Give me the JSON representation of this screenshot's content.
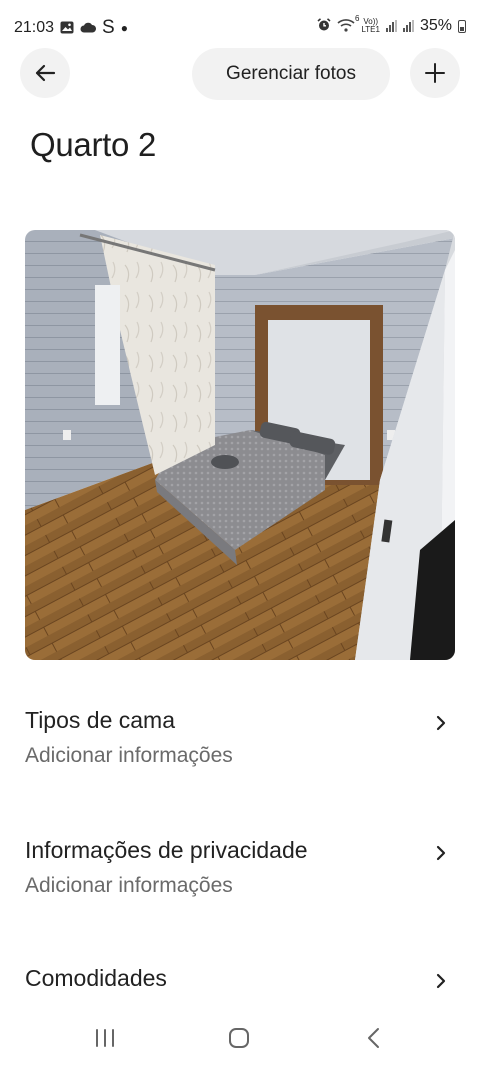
{
  "status_bar": {
    "time": "21:03",
    "app_letter": "S",
    "network_top": "Vo))",
    "network_bottom": "LTE1",
    "wifi_badge": "6",
    "battery": "35%"
  },
  "header": {
    "manage_photos_label": "Gerenciar fotos",
    "back_icon": "arrow-left-icon",
    "add_icon": "plus-icon"
  },
  "page": {
    "title": "Quarto 2"
  },
  "photo": {
    "icon": "room-photo"
  },
  "list": [
    {
      "title": "Tipos de cama",
      "subtitle": "Adicionar informações"
    },
    {
      "title": "Informações de privacidade",
      "subtitle": "Adicionar informações"
    },
    {
      "title": "Comodidades"
    }
  ],
  "nav_bar": {
    "icons": [
      "recents-icon",
      "home-icon",
      "back-icon"
    ]
  },
  "colors": {
    "button_bg": "#f2f2f2",
    "text": "#222222",
    "subtext": "#6a6a6a"
  }
}
